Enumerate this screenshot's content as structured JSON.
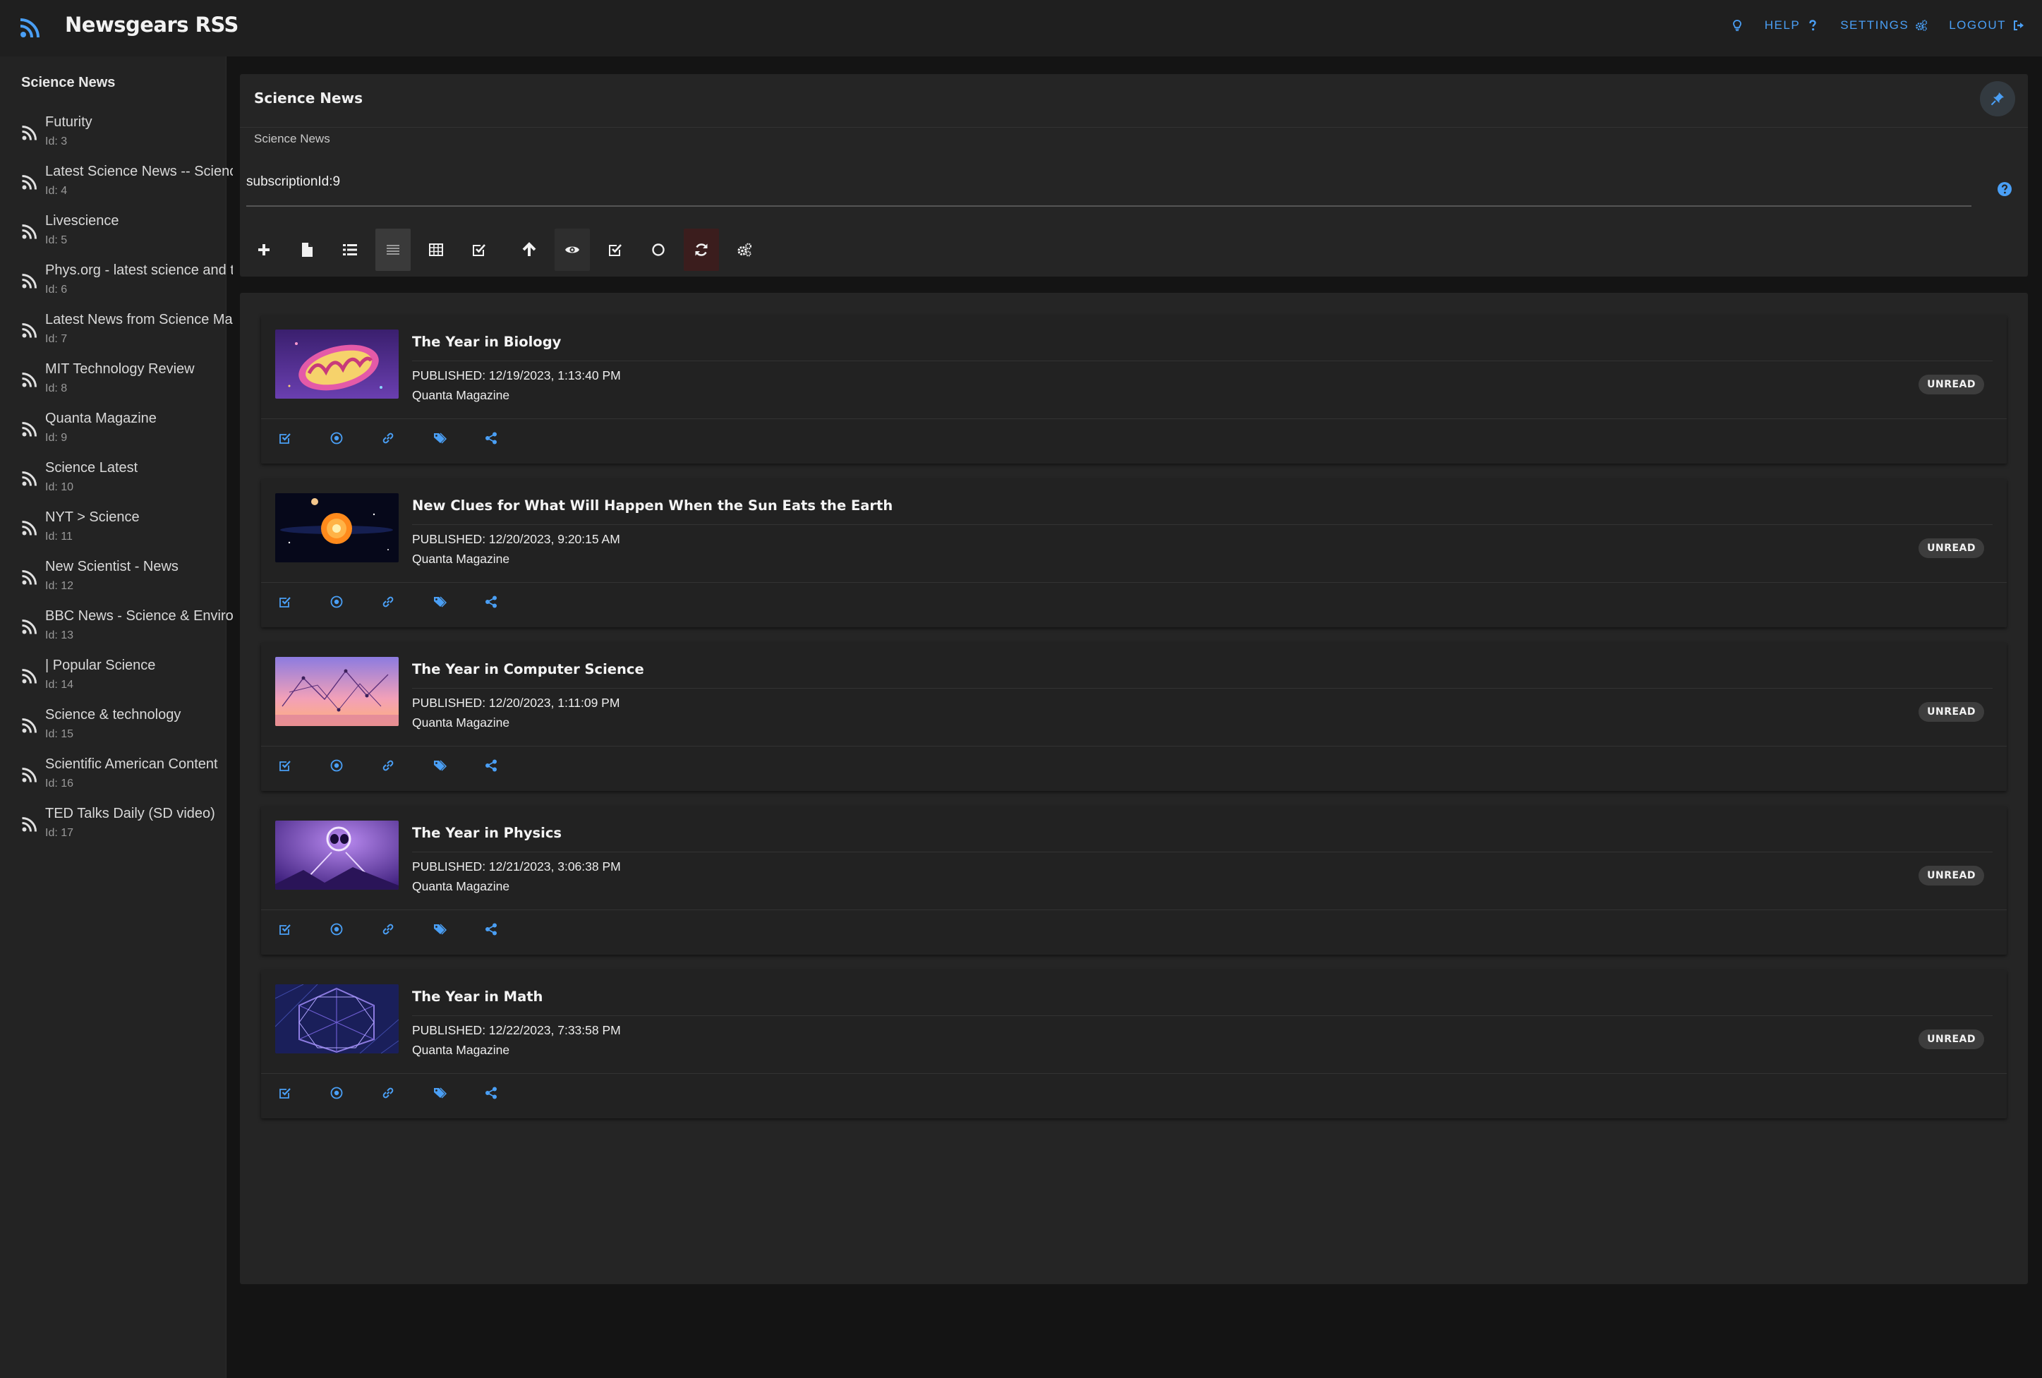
{
  "app": {
    "title": "Newsgears RSS"
  },
  "topnav": [
    {
      "label": "",
      "icon": "lightbulb-icon"
    },
    {
      "label": "HELP",
      "icon": "question-icon"
    },
    {
      "label": "SETTINGS",
      "icon": "cogs-icon"
    },
    {
      "label": "LOGOUT",
      "icon": "sign-out-icon"
    }
  ],
  "sidebar": {
    "title": "Science News",
    "feeds": [
      {
        "name": "Futurity",
        "id": "Id: 3"
      },
      {
        "name": "Latest Science News -- ScienceDaily",
        "id": "Id: 4"
      },
      {
        "name": "Livescience",
        "id": "Id: 5"
      },
      {
        "name": "Phys.org - latest science and technology news",
        "id": "Id: 6"
      },
      {
        "name": "Latest News from Science Magazine",
        "id": "Id: 7"
      },
      {
        "name": "MIT Technology Review",
        "id": "Id: 8"
      },
      {
        "name": "Quanta Magazine",
        "id": "Id: 9"
      },
      {
        "name": "Science Latest",
        "id": "Id: 10"
      },
      {
        "name": "NYT > Science",
        "id": "Id: 11"
      },
      {
        "name": "New Scientist - News",
        "id": "Id: 12"
      },
      {
        "name": "BBC News - Science & Environment",
        "id": "Id: 13"
      },
      {
        "name": "| Popular Science",
        "id": "Id: 14"
      },
      {
        "name": "Science & technology",
        "id": "Id: 15"
      },
      {
        "name": "Scientific American Content",
        "id": "Id: 16"
      },
      {
        "name": "TED Talks Daily (SD video)",
        "id": "Id: 17"
      }
    ]
  },
  "header": {
    "title": "Science News",
    "breadcrumb": "Science News",
    "query": "subscriptionId:9",
    "toolbar": [
      "add-icon",
      "file-icon",
      "list-icon",
      "compact-list-icon",
      "table-icon",
      "check-square-icon",
      "arrow-up-icon",
      "eye-icon",
      "check-square-icon",
      "circle-icon",
      "refresh-icon",
      "cogs-icon"
    ]
  },
  "articles": [
    {
      "title": "The Year in Biology",
      "published": "PUBLISHED: 12/19/2023, 1:13:40 PM",
      "source": "Quanta Magazine",
      "status": "UNREAD"
    },
    {
      "title": "New Clues for What Will Happen When the Sun Eats the Earth",
      "published": "PUBLISHED: 12/20/2023, 9:20:15 AM",
      "source": "Quanta Magazine",
      "status": "UNREAD"
    },
    {
      "title": "The Year in Computer Science",
      "published": "PUBLISHED: 12/20/2023, 1:11:09 PM",
      "source": "Quanta Magazine",
      "status": "UNREAD"
    },
    {
      "title": "The Year in Physics",
      "published": "PUBLISHED: 12/21/2023, 3:06:38 PM",
      "source": "Quanta Magazine",
      "status": "UNREAD"
    },
    {
      "title": "The Year in Math",
      "published": "PUBLISHED: 12/22/2023, 7:33:58 PM",
      "source": "Quanta Magazine",
      "status": "UNREAD"
    }
  ],
  "colors": {
    "accent": "#4a9ff5",
    "background": "#141414",
    "panel": "#252525",
    "sidebar": "#232323"
  }
}
